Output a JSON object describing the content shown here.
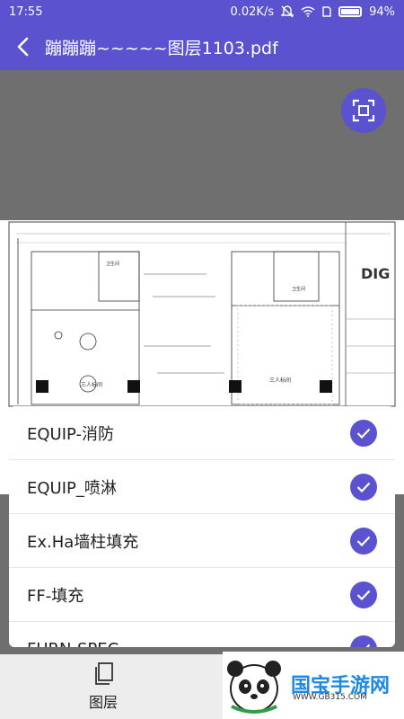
{
  "status_bar": {
    "time": "17:55",
    "network_speed": "0.02K/s",
    "battery": "94%",
    "battery_level": 0.94
  },
  "app_bar": {
    "title": "蹦蹦蹦~~~~~图层1103.pdf"
  },
  "layers": [
    {
      "name": "EQUIP-消防",
      "checked": true
    },
    {
      "name": "EQUIP_喷淋",
      "checked": true
    },
    {
      "name": "Ex.Ha墙柱填充",
      "checked": true
    },
    {
      "name": "FF-填充",
      "checked": true
    },
    {
      "name": "FURN-SPEC",
      "checked": true
    }
  ],
  "drawing": {
    "room_label_left": "三人标间",
    "room_label_right": "三人标间",
    "bath_label": "卫生间",
    "logo": "DIG"
  },
  "bottom_bar": {
    "layers_tab_label": "图层"
  },
  "watermark": {
    "text": "国宝手游网",
    "url": "WWW.GB315.COM"
  },
  "colors": {
    "accent": "#5a52cf",
    "viewer_bg": "#6f6f6f"
  }
}
